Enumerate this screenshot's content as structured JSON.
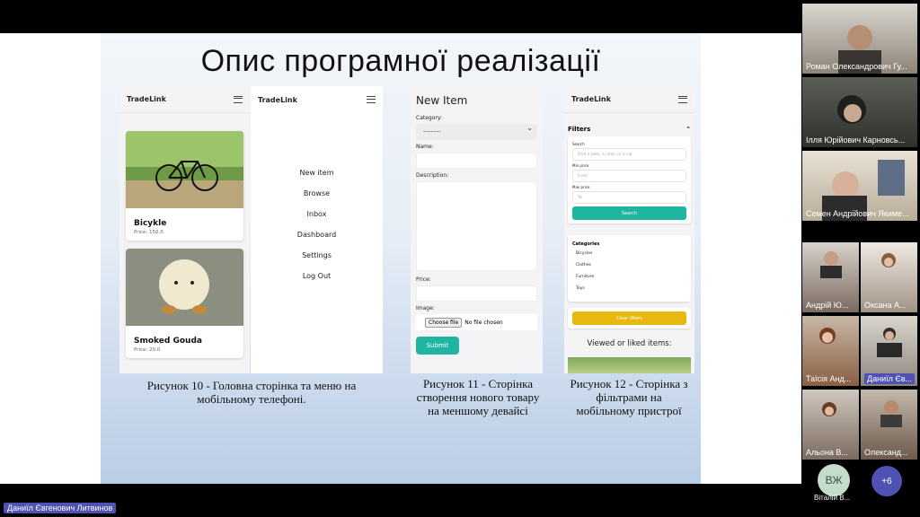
{
  "slide": {
    "title": "Опис програмної реалізації",
    "captions": {
      "fig10": "Рисунок 10 - Головна сторінка та меню на мобільному телефоні.",
      "fig11": "Рисунок 11 - Сторінка створення нового товару на меншому девайсі",
      "fig12": "Рисунок 12 - Сторінка з фільтрами на мобільному пристрої"
    },
    "home": {
      "brand": "TradeLink",
      "cards": [
        {
          "title": "Bicykle",
          "price": "Price: 150.0"
        },
        {
          "title": "Smoked Gouda",
          "price": "Price: 20.0"
        }
      ]
    },
    "menu": {
      "brand": "TradeLink",
      "items": [
        "New item",
        "Browse",
        "Inbox",
        "Dashboard",
        "Settings",
        "Log Out"
      ]
    },
    "new_item": {
      "heading": "New Item",
      "category_label": "Category:",
      "category_value": "---------",
      "name_label": "Name:",
      "description_label": "Description:",
      "price_label": "Price:",
      "image_label": "Image:",
      "choose_file": "Choose file",
      "no_file": "No file chosen",
      "submit": "Submit"
    },
    "filters": {
      "brand": "TradeLink",
      "heading": "Filters",
      "search_label": "Search",
      "search_placeholder": "Find a bike, a chair or a car",
      "min_label": "Min price",
      "min_placeholder": "From",
      "max_label": "Max price",
      "max_placeholder": "To",
      "search_button": "Search",
      "categories_title": "Categories",
      "categories": [
        "Bicycles",
        "Clothes",
        "Furniture",
        "Toys"
      ],
      "clear_button": "Clear filters",
      "viewed": "Viewed or liked items:"
    }
  },
  "participants": [
    {
      "name": "Роман Олександрович Гу..."
    },
    {
      "name": "Ілля Юрійович Карновсь..."
    },
    {
      "name": "Семен Андрійович Якиме..."
    },
    {
      "name": "Андрій Ю..."
    },
    {
      "name": "Оксана А..."
    },
    {
      "name": "Таїсія Анд..."
    },
    {
      "name": "Даниїл Єв..."
    },
    {
      "name": "Альона В..."
    },
    {
      "name": "Олександ..."
    }
  ],
  "avatar": {
    "initials": "ВЖ",
    "name": "Віталій В..."
  },
  "more_count": "+6",
  "presenter": "Даниїл Євгенович Литвинов"
}
